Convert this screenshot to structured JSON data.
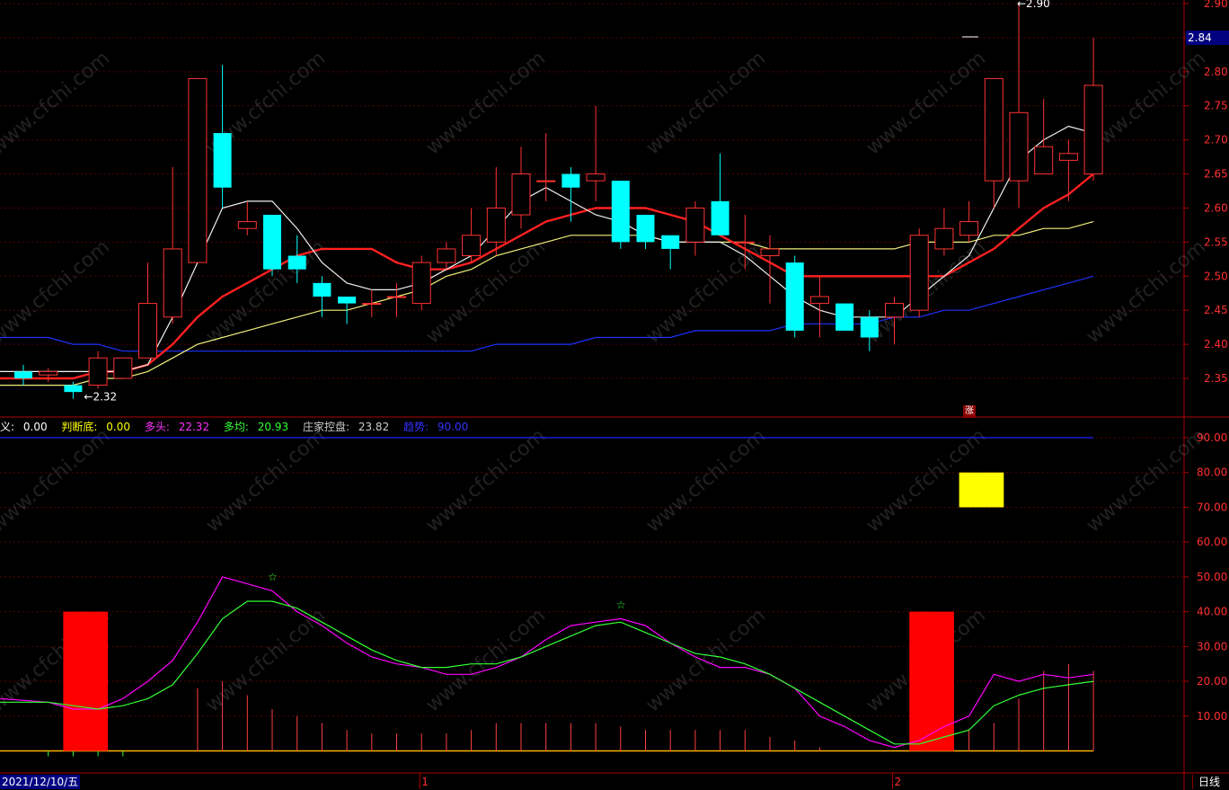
{
  "chart_data": [
    {
      "type": "candlestick",
      "ylim": [
        2.31,
        2.91
      ],
      "y_ticks": [
        "2.90",
        "2.85",
        "2.80",
        "2.75",
        "2.70",
        "2.65",
        "2.60",
        "2.55",
        "2.50",
        "2.45",
        "2.40",
        "2.35"
      ],
      "candles": [
        [
          2.36,
          2.35,
          2.37,
          2.34
        ],
        [
          2.355,
          2.36,
          2.365,
          2.345
        ],
        [
          2.34,
          2.33,
          2.345,
          2.32
        ],
        [
          2.34,
          2.38,
          2.39,
          2.335
        ],
        [
          2.35,
          2.38,
          2.38,
          2.35
        ],
        [
          2.38,
          2.46,
          2.52,
          2.38
        ],
        [
          2.44,
          2.54,
          2.66,
          2.43
        ],
        [
          2.52,
          2.79,
          2.79,
          2.52
        ],
        [
          2.71,
          2.63,
          2.81,
          2.6
        ],
        [
          2.57,
          2.58,
          2.61,
          2.56
        ],
        [
          2.59,
          2.51,
          2.59,
          2.5
        ],
        [
          2.53,
          2.51,
          2.56,
          2.49
        ],
        [
          2.49,
          2.47,
          2.5,
          2.44
        ],
        [
          2.47,
          2.46,
          2.47,
          2.43
        ],
        [
          2.46,
          2.46,
          2.48,
          2.44
        ],
        [
          2.47,
          2.47,
          2.49,
          2.44
        ],
        [
          2.46,
          2.52,
          2.53,
          2.45
        ],
        [
          2.52,
          2.54,
          2.55,
          2.51
        ],
        [
          2.53,
          2.56,
          2.6,
          2.52
        ],
        [
          2.55,
          2.6,
          2.66,
          2.53
        ],
        [
          2.59,
          2.65,
          2.69,
          2.57
        ],
        [
          2.64,
          2.64,
          2.71,
          2.61
        ],
        [
          2.65,
          2.63,
          2.66,
          2.58
        ],
        [
          2.64,
          2.65,
          2.75,
          2.61
        ],
        [
          2.64,
          2.55,
          2.64,
          2.54
        ],
        [
          2.59,
          2.55,
          2.59,
          2.54
        ],
        [
          2.56,
          2.54,
          2.56,
          2.51
        ],
        [
          2.55,
          2.6,
          2.61,
          2.53
        ],
        [
          2.61,
          2.56,
          2.68,
          2.56
        ],
        [
          2.55,
          2.55,
          2.59,
          2.51
        ],
        [
          2.53,
          2.54,
          2.56,
          2.46
        ],
        [
          2.52,
          2.42,
          2.53,
          2.41
        ],
        [
          2.46,
          2.47,
          2.5,
          2.41
        ],
        [
          2.46,
          2.42,
          2.46,
          2.42
        ],
        [
          2.44,
          2.41,
          2.45,
          2.39
        ],
        [
          2.44,
          2.46,
          2.47,
          2.4
        ],
        [
          2.45,
          2.56,
          2.57,
          2.44
        ],
        [
          2.54,
          2.57,
          2.6,
          2.53
        ],
        [
          2.56,
          2.58,
          2.61,
          2.55
        ],
        [
          2.64,
          2.79,
          2.79,
          2.6
        ],
        [
          2.64,
          2.74,
          2.9,
          2.6
        ],
        [
          2.65,
          2.69,
          2.76,
          2.65
        ],
        [
          2.67,
          2.68,
          2.7,
          2.61
        ],
        [
          2.65,
          2.78,
          2.85,
          2.64
        ]
      ],
      "ma_white": [
        2.36,
        2.36,
        2.36,
        2.36,
        2.36,
        2.37,
        2.44,
        2.52,
        2.6,
        2.61,
        2.61,
        2.57,
        2.52,
        2.49,
        2.48,
        2.48,
        2.49,
        2.51,
        2.53,
        2.57,
        2.61,
        2.63,
        2.61,
        2.59,
        2.58,
        2.56,
        2.55,
        2.55,
        2.55,
        2.53,
        2.5,
        2.47,
        2.45,
        2.44,
        2.44,
        2.44,
        2.47,
        2.5,
        2.53,
        2.6,
        2.67,
        2.7,
        2.72,
        2.71
      ],
      "ma_red": [
        2.35,
        2.35,
        2.35,
        2.36,
        2.36,
        2.37,
        2.4,
        2.44,
        2.47,
        2.49,
        2.51,
        2.53,
        2.54,
        2.54,
        2.54,
        2.52,
        2.51,
        2.51,
        2.52,
        2.54,
        2.56,
        2.58,
        2.59,
        2.6,
        2.6,
        2.6,
        2.59,
        2.58,
        2.56,
        2.54,
        2.52,
        2.5,
        2.5,
        2.5,
        2.5,
        2.5,
        2.5,
        2.5,
        2.52,
        2.54,
        2.57,
        2.6,
        2.62,
        2.65
      ],
      "ma_yellow": [
        2.34,
        2.34,
        2.34,
        2.35,
        2.35,
        2.36,
        2.38,
        2.4,
        2.41,
        2.42,
        2.43,
        2.44,
        2.45,
        2.45,
        2.46,
        2.47,
        2.48,
        2.5,
        2.51,
        2.53,
        2.54,
        2.55,
        2.56,
        2.56,
        2.56,
        2.56,
        2.55,
        2.55,
        2.55,
        2.55,
        2.54,
        2.54,
        2.54,
        2.54,
        2.54,
        2.54,
        2.55,
        2.55,
        2.55,
        2.56,
        2.56,
        2.57,
        2.57,
        2.58
      ],
      "ma_blue": [
        2.41,
        2.41,
        2.4,
        2.4,
        2.39,
        2.39,
        2.39,
        2.39,
        2.39,
        2.39,
        2.39,
        2.39,
        2.39,
        2.39,
        2.39,
        2.39,
        2.39,
        2.39,
        2.39,
        2.4,
        2.4,
        2.4,
        2.4,
        2.41,
        2.41,
        2.41,
        2.41,
        2.42,
        2.42,
        2.42,
        2.42,
        2.43,
        2.43,
        2.43,
        2.43,
        2.44,
        2.44,
        2.45,
        2.45,
        2.46,
        2.47,
        2.48,
        2.49,
        2.5
      ],
      "annotations": {
        "low_label": "2.32",
        "high_label": "2.90",
        "last_price": "2.84"
      }
    },
    {
      "type": "line",
      "ylim": [
        0,
        95
      ],
      "y_ticks": [
        "90.00",
        "80.00",
        "70.00",
        "60.00",
        "50.00",
        "40.00",
        "30.00",
        "20.00",
        "10.00"
      ],
      "series": [
        {
          "name": "多头",
          "color": "#ff00ff",
          "values": [
            15,
            14,
            12,
            12,
            15,
            20,
            26,
            37,
            50,
            48,
            46,
            40,
            36,
            31,
            27,
            25,
            24,
            22,
            22,
            24,
            27,
            32,
            36,
            37,
            38,
            36,
            31,
            27,
            24,
            24,
            22,
            18,
            10,
            7,
            3,
            1,
            3,
            7,
            10,
            22,
            20,
            22,
            21,
            22
          ]
        },
        {
          "name": "多均",
          "color": "#33ff33",
          "values": [
            14,
            14,
            13,
            12,
            13,
            15,
            19,
            28,
            38,
            43,
            43,
            41,
            37,
            33,
            29,
            26,
            24,
            24,
            25,
            25,
            27,
            30,
            33,
            36,
            37,
            34,
            31,
            28,
            27,
            25,
            22,
            18,
            14,
            10,
            6,
            2,
            2,
            4,
            6,
            13,
            16,
            18,
            19,
            20
          ]
        }
      ],
      "legend": [
        {
          "label": "义:",
          "value": "0.00",
          "color": "#ffffff"
        },
        {
          "label": "判断底:",
          "value": "0.00",
          "color": "#ffff00"
        },
        {
          "label": "多头:",
          "value": "22.32",
          "color": "#ff33ff"
        },
        {
          "label": "多均:",
          "value": "20.93",
          "color": "#33ff33"
        },
        {
          "label": "庄家控盘:",
          "value": "23.82",
          "color": "#cccccc"
        },
        {
          "label": "趋势:",
          "value": "90.00",
          "color": "#3333ff"
        }
      ],
      "control_bars": [
        0,
        0,
        0,
        0,
        0,
        0,
        0,
        18,
        20,
        16,
        12,
        10,
        8,
        6,
        5,
        5,
        5,
        5,
        6,
        8,
        8,
        8,
        8,
        8,
        7,
        6,
        6,
        6,
        6,
        6,
        4,
        3,
        1,
        0,
        0,
        0,
        2,
        4,
        6,
        8,
        15,
        23,
        25,
        23
      ],
      "red_blocks": [
        {
          "from": 2,
          "to": 3,
          "value": 40
        },
        {
          "from": 36,
          "to": 37,
          "value": 40
        }
      ],
      "yellow_block": {
        "from": 38,
        "to": 39,
        "bottom": 70,
        "top": 80
      },
      "trend_value": 90
    }
  ],
  "x_axis": {
    "date_label": "2021/12/10/五",
    "month_marks": [
      "1",
      "2"
    ]
  },
  "period_label": "日线",
  "badge_label": "涨",
  "watermark_text": "www.cfchi.com"
}
